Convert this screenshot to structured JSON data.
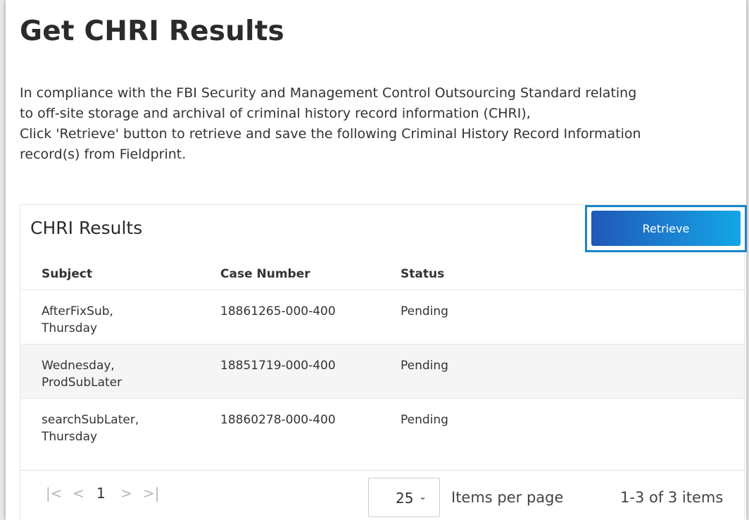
{
  "page": {
    "title": "Get CHRI Results",
    "intro_lines": [
      "In compliance with the FBI Security and Management Control Outsourcing Standard relating",
      "to off-site storage and archival of criminal history record information (CHRI),",
      "Click 'Retrieve' button to retrieve and save the following Criminal History Record Information",
      "record(s) from Fieldprint."
    ]
  },
  "card": {
    "title": "CHRI Results",
    "retrieve_label": "Retrieve",
    "columns": [
      "Subject",
      "Case Number",
      "Status"
    ],
    "rows": [
      {
        "subject_line1": "AfterFixSub,",
        "subject_line2": "Thursday",
        "case_number": "18861265-000-400",
        "status": "Pending"
      },
      {
        "subject_line1": "Wednesday,",
        "subject_line2": "ProdSubLater",
        "case_number": "18851719-000-400",
        "status": "Pending"
      },
      {
        "subject_line1": "searchSubLater,",
        "subject_line2": "Thursday",
        "case_number": "18860278-000-400",
        "status": "Pending"
      }
    ]
  },
  "pager": {
    "first_icon": "first-page-icon",
    "prev_icon": "prev-page-icon",
    "current_page": "1",
    "next_icon": "next-page-icon",
    "last_icon": "last-page-icon",
    "page_size": "25",
    "items_per_page_label": "Items per page",
    "count_text": "1-3 of 3 items"
  },
  "colors": {
    "accent_outline": "#1a86c8",
    "button_gradient_start": "#1f58b8",
    "button_gradient_end": "#12a7e6",
    "alt_row": "#f5f5f5"
  }
}
